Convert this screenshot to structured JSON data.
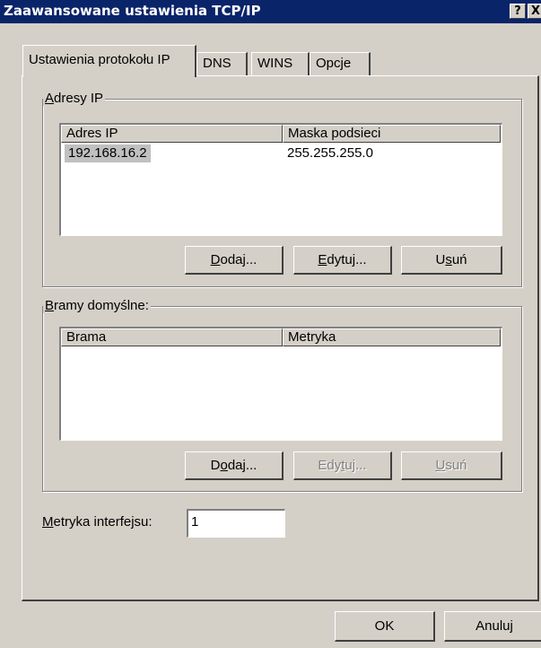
{
  "window": {
    "title": "Zaawansowane ustawienia TCP/IP",
    "help_button": "?",
    "close_button": "X"
  },
  "tabs": [
    {
      "label": "Ustawienia protokołu IP",
      "active": true
    },
    {
      "label": "DNS",
      "active": false
    },
    {
      "label": "WINS",
      "active": false
    },
    {
      "label": "Opcje",
      "active": false
    }
  ],
  "ip_addresses": {
    "legend_hotkey": "A",
    "legend_rest": "dresy IP",
    "columns": [
      "Adres IP",
      "Maska podsieci"
    ],
    "rows": [
      {
        "ip": "192.168.16.2",
        "mask": "255.255.255.0",
        "selected": true
      }
    ],
    "buttons": {
      "add": {
        "hotkey": "D",
        "rest": "odaj...",
        "enabled": true
      },
      "edit": {
        "hotkey": "E",
        "rest": "dytuj...",
        "enabled": true
      },
      "remove": {
        "pre": "U",
        "hotkey": "s",
        "rest": "uń",
        "enabled": true
      }
    }
  },
  "gateways": {
    "legend_hotkey": "B",
    "legend_rest": "ramy domyślne:",
    "columns": [
      "Brama",
      "Metryka"
    ],
    "rows": [],
    "buttons": {
      "add": {
        "pre": "D",
        "hotkey": "o",
        "rest": "daj...",
        "enabled": true
      },
      "edit": {
        "pre": "Edy",
        "hotkey": "t",
        "rest": "uj...",
        "enabled": false
      },
      "remove": {
        "hotkey": "U",
        "rest": "suń",
        "enabled": false
      }
    }
  },
  "interface_metric": {
    "label_hotkey": "M",
    "label_rest": "etryka interfejsu:",
    "value": "1"
  },
  "footer": {
    "ok_label": "OK",
    "cancel_label": "Anuluj"
  },
  "colors": {
    "title_bar": "#0a246a",
    "face": "#d4d0c8",
    "selection": "#c0c0c0"
  }
}
